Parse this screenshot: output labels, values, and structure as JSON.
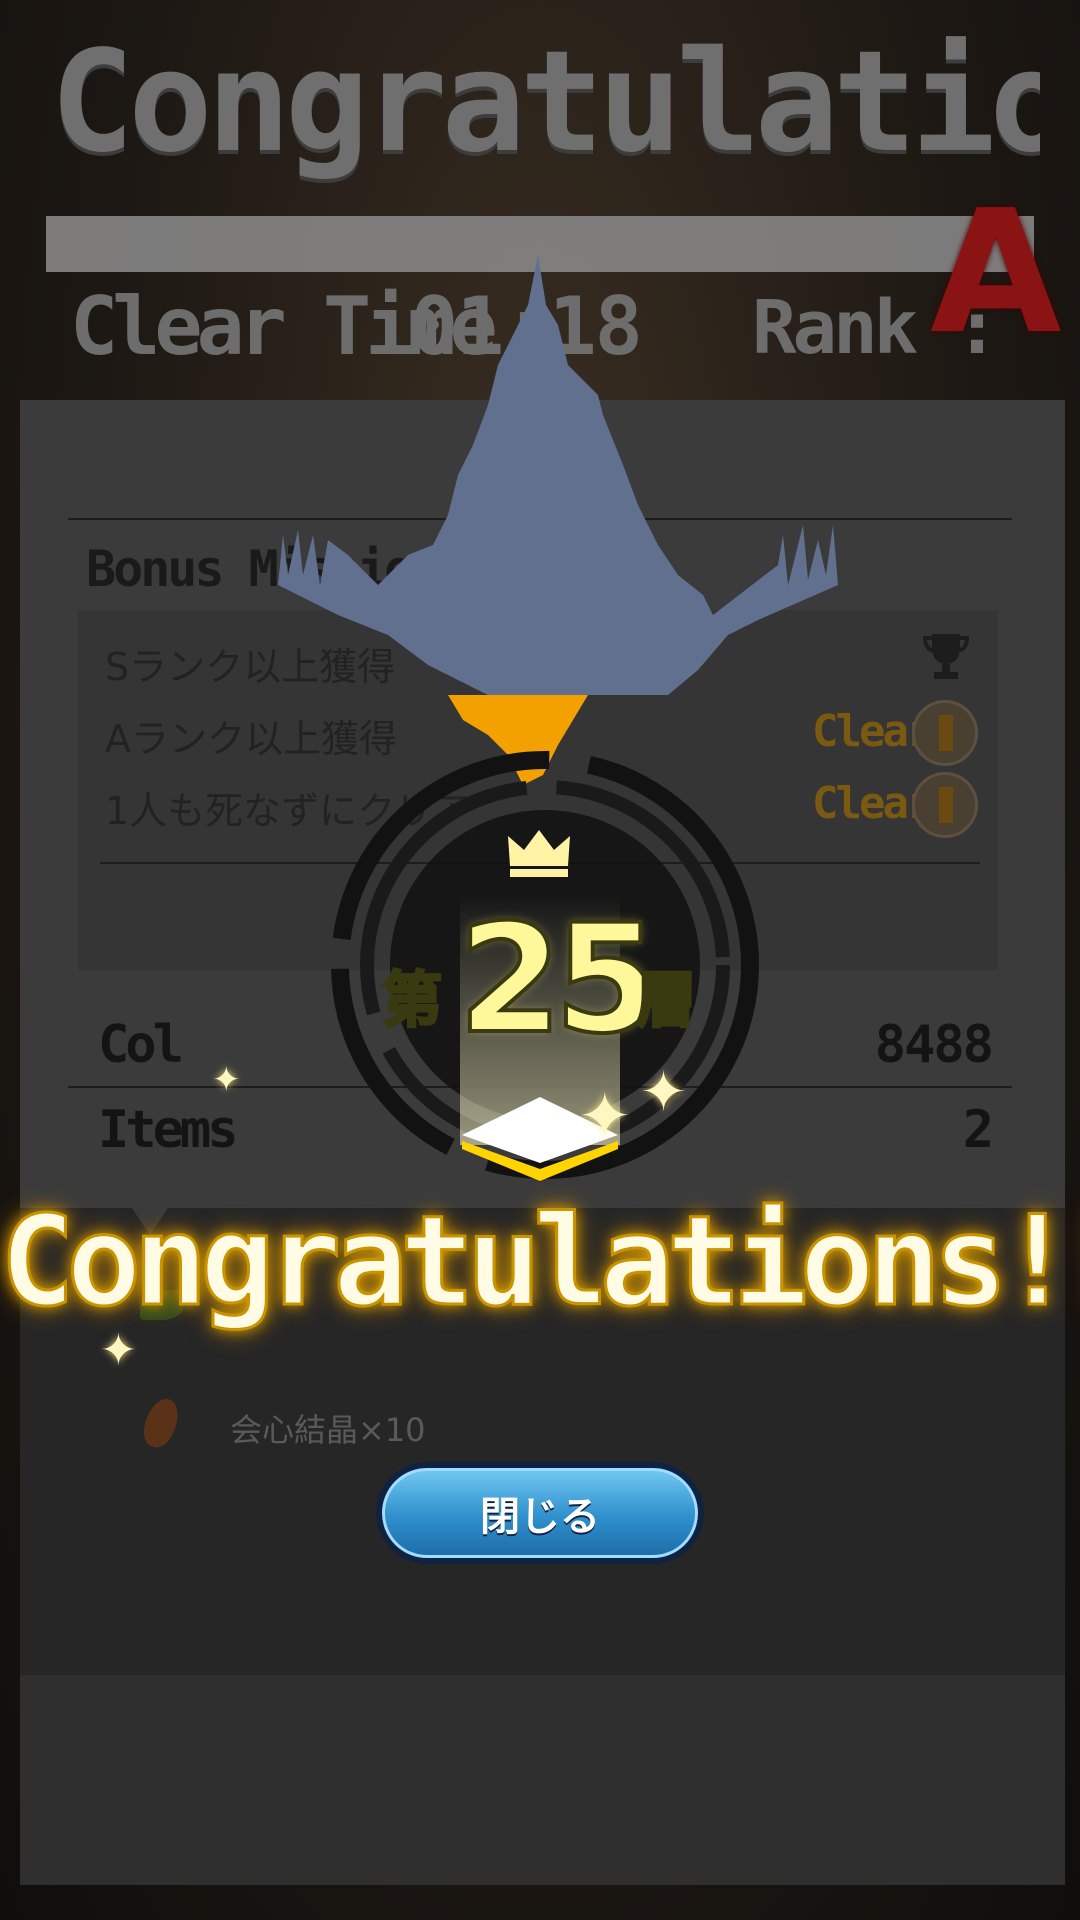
{
  "header": {
    "title": "Congratulations!!",
    "clear_time_label": "Clear Time",
    "clear_time_value": "01:18",
    "rank_label": "Rank :",
    "rank_value": "A"
  },
  "bonus": {
    "title": "Bonus Missions",
    "missions": [
      {
        "label": "Sランク以上獲得",
        "status": ""
      },
      {
        "label": "Aランク以上獲得",
        "status": "Clear"
      },
      {
        "label": "1人も死なずにクリア",
        "status": "Clear"
      }
    ]
  },
  "stats": {
    "col_label": "Col",
    "col_value": "8488",
    "items_label": "Items",
    "items_value": "2"
  },
  "rewards": {
    "item_2": "会心結晶×10"
  },
  "close_button": "閉じる",
  "overlay": {
    "floor_prefix": "第",
    "floor_number": "25",
    "floor_suffix": "層",
    "congrats": "Congratulations!!"
  },
  "colors": {
    "gold": "#ffd400",
    "rank": "#8a1414",
    "button": "#2f8fcd"
  },
  "icons": [
    "trophy-icon",
    "medal-icon",
    "crown-icon",
    "crystal-icon",
    "leaf-icon",
    "sparkle-icon"
  ]
}
